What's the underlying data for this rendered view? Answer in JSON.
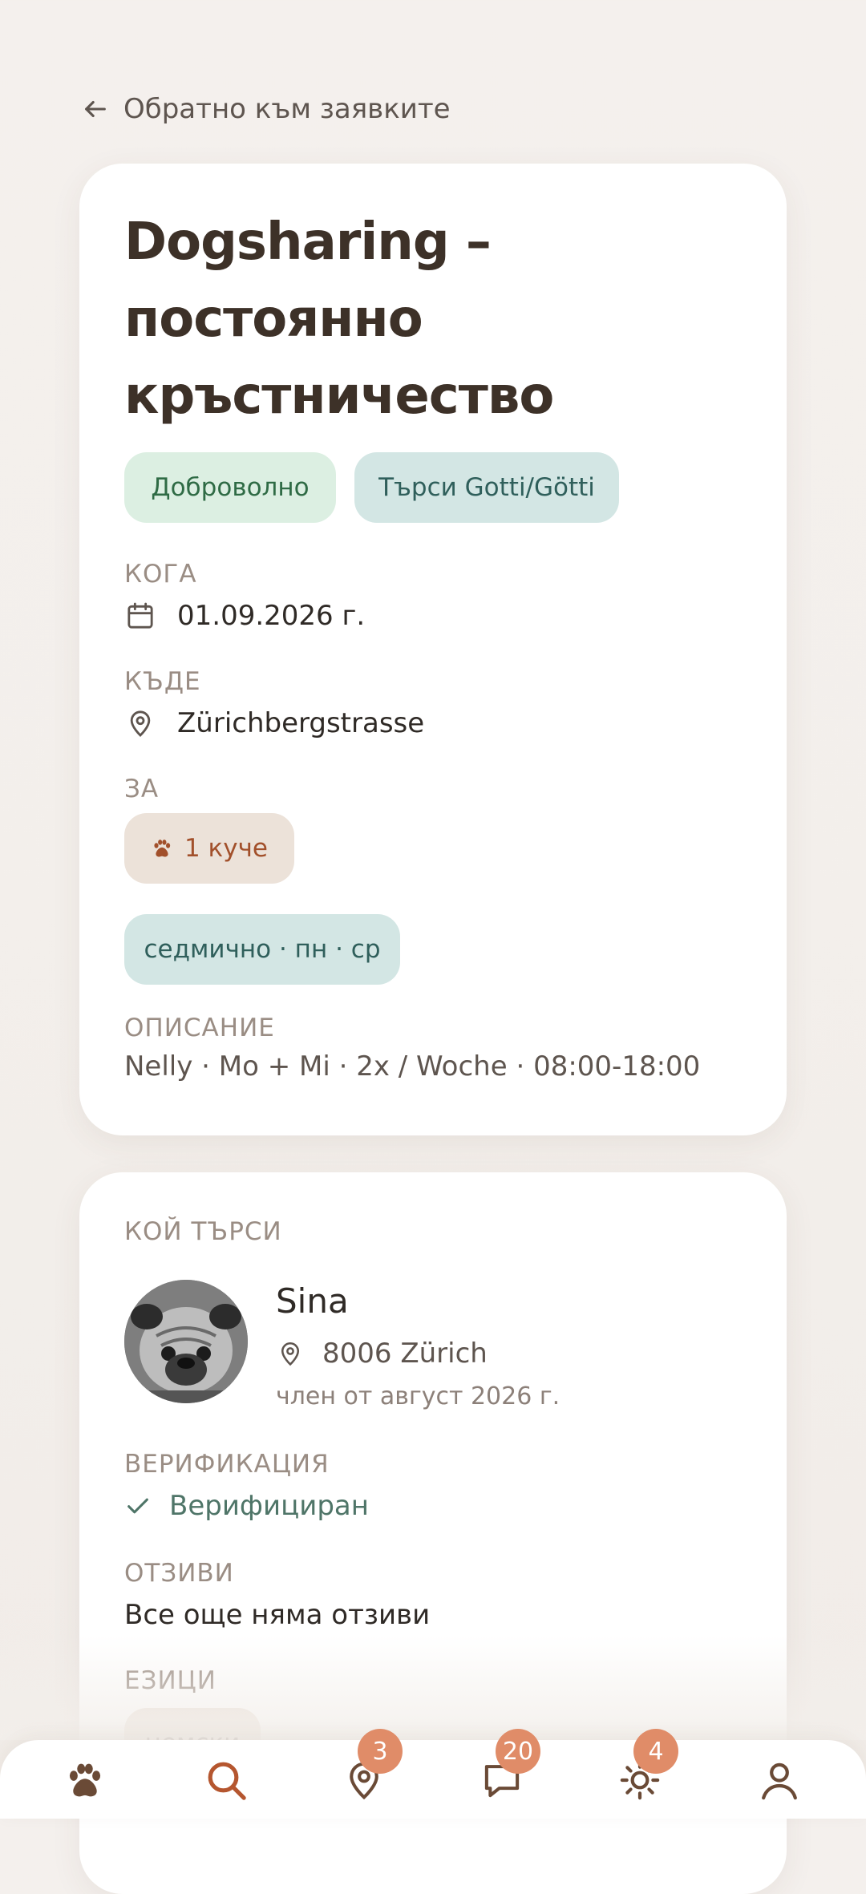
{
  "back_link": {
    "label": "Обратно към заявките"
  },
  "request": {
    "title": "Dogsharing – постоянно кръстничество",
    "tags": [
      "Доброволно",
      "Търси Gotti/Götti"
    ],
    "when": {
      "label": "КОГА",
      "value": "01.09.2026 г."
    },
    "where": {
      "label": "КЪДЕ",
      "value": "Zürichbergstrasse"
    },
    "for": {
      "label": "ЗА",
      "pet_chip": "1 куче",
      "schedule_chip": "седмично · пн · ср"
    },
    "description": {
      "label": "ОПИСАНИЕ",
      "text": "Nelly · Mo + Mi · 2x / Woche · 08:00-18:00"
    }
  },
  "requester": {
    "section_label": "КОЙ ТЪРСИ",
    "name": "Sina",
    "location": "8006 Zürich",
    "member_since": "член от август 2026 г.",
    "verification": {
      "label": "ВЕРИФИКАЦИЯ",
      "status": "Верифициран"
    },
    "reviews": {
      "label": "ОТЗИВИ",
      "text": "Все още няма отзиви"
    },
    "languages": {
      "label": "ЕЗИЦИ",
      "items": [
        "немски"
      ]
    }
  },
  "bottom_nav": {
    "items": [
      {
        "icon": "paw-icon",
        "badge": ""
      },
      {
        "icon": "search-icon",
        "badge": ""
      },
      {
        "icon": "map-pin-icon",
        "badge": "3"
      },
      {
        "icon": "chat-icon",
        "badge": "20"
      },
      {
        "icon": "sun-icon",
        "badge": "4"
      },
      {
        "icon": "profile-icon",
        "badge": ""
      }
    ]
  },
  "colors": {
    "accent": "#b5562f",
    "badge": "#e08c68",
    "tag_green_bg": "#dcefe2",
    "tag_teal_bg": "#d3e6e4",
    "pet_chip_bg": "#ece2d9"
  }
}
